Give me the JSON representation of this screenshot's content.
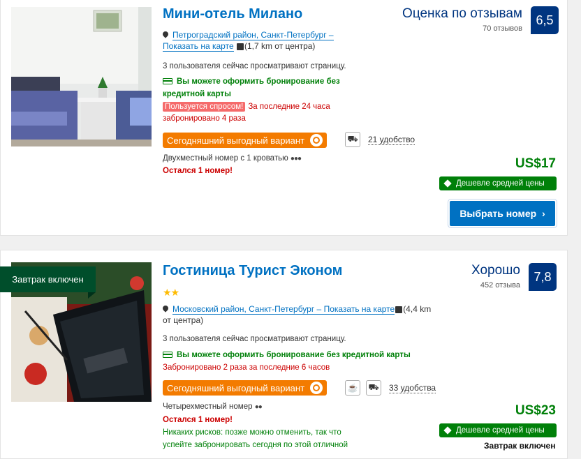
{
  "hotels": [
    {
      "name": "Мини-отель Милано",
      "score_label": "Оценка по отзывам",
      "reviews": "70 отзывов",
      "score": "6,5",
      "location_link_1": "Петроградский район, Санкт-Петербург –",
      "location_link_2": "Показать на карте",
      "distance": "(1,7 km от центра)",
      "viewers": "3 пользователя сейчас просматривают страницу.",
      "no_card_1": "Вы можете оформить бронирование без",
      "no_card_2": "кредитной карты",
      "demand_badge": "Пользуется спросом!",
      "demand_text": "За последние 24 часа",
      "booked_text": "забронировано 4 раза",
      "deal": "Сегодняшний выгодный вариант",
      "amenities": "21 удобство",
      "room": "Двухместный номер с 1 кроватью",
      "left": "Остался 1 номер!",
      "price": "US$17",
      "cheaper": "Дешевле средней цены",
      "button": "Выбрать номер",
      "button_chevron": "›"
    },
    {
      "badge": "Завтрак включен",
      "name": "Гостиница Турист Эконом",
      "stars": "★★",
      "score_label": "Хорошо",
      "reviews": "452 отзыва",
      "score": "7,8",
      "location_link": "Московский район, Санкт-Петербург – Показать на карте",
      "distance_1": "(4,4 km",
      "distance_2": "от центра)",
      "viewers": "3 пользователя сейчас просматривают страницу.",
      "no_card": "Вы можете оформить бронирование без кредитной карты",
      "booked_text": "Забронировано 2 раза за последние 6 часов",
      "deal": "Сегодняшний выгодный вариант",
      "amenities": "33 удобства",
      "room": "Четырехместный номер",
      "left": "Остался 1 номер!",
      "risk_1": "Никаких рисков: позже можно отменить, так что",
      "risk_2": "успейте забронировать сегодня по этой отличной",
      "price": "US$23",
      "cheaper": "Дешевле средней цены",
      "breakfast_cut": "Завтрак включен"
    }
  ],
  "colors": {
    "brand_blue": "#003580",
    "link_blue": "#0071c2",
    "green": "#008009",
    "deal_orange": "#f37b00",
    "red": "#cc0000"
  }
}
